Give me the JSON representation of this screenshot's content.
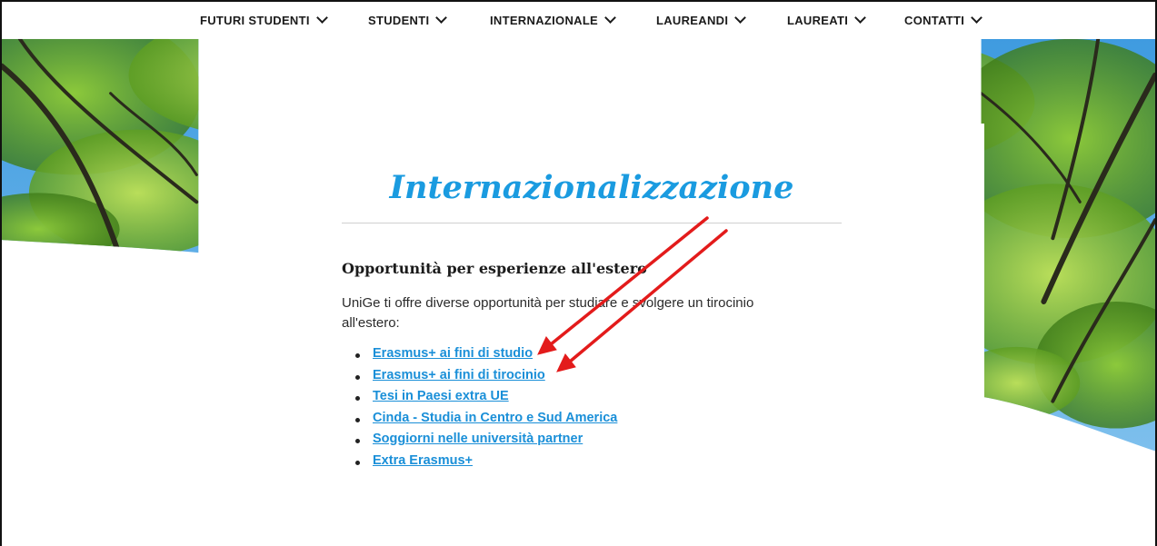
{
  "nav": {
    "items": [
      {
        "label": "FUTURI STUDENTI"
      },
      {
        "label": "STUDENTI"
      },
      {
        "label": "INTERNAZIONALE"
      },
      {
        "label": "LAUREANDI"
      },
      {
        "label": "LAUREATI"
      },
      {
        "label": "CONTATTI"
      }
    ]
  },
  "page": {
    "title": "Internazionalizzazione",
    "section_heading": "Opportunità per esperienze all'estero",
    "intro": "UniGe ti offre diverse opportunità per studiare e svolgere un tirocinio all'estero:",
    "links": [
      {
        "label": "Erasmus+ ai fini di studio"
      },
      {
        "label": "Erasmus+ ai fini di tirocinio"
      },
      {
        "label": "Tesi in Paesi extra UE"
      },
      {
        "label": "Cinda - Studia in Centro e Sud America"
      },
      {
        "label": "Soggiorni nelle università partner"
      },
      {
        "label": "Extra Erasmus+"
      }
    ]
  },
  "colors": {
    "accent_blue": "#1a9be0",
    "annotation_arrow": "#e31b1b",
    "foliage": "#6fb52d",
    "sky": "#4aa3e6"
  },
  "icons": {
    "nav_dropdown": "chevron-down-icon",
    "annotation": "red-arrow"
  }
}
